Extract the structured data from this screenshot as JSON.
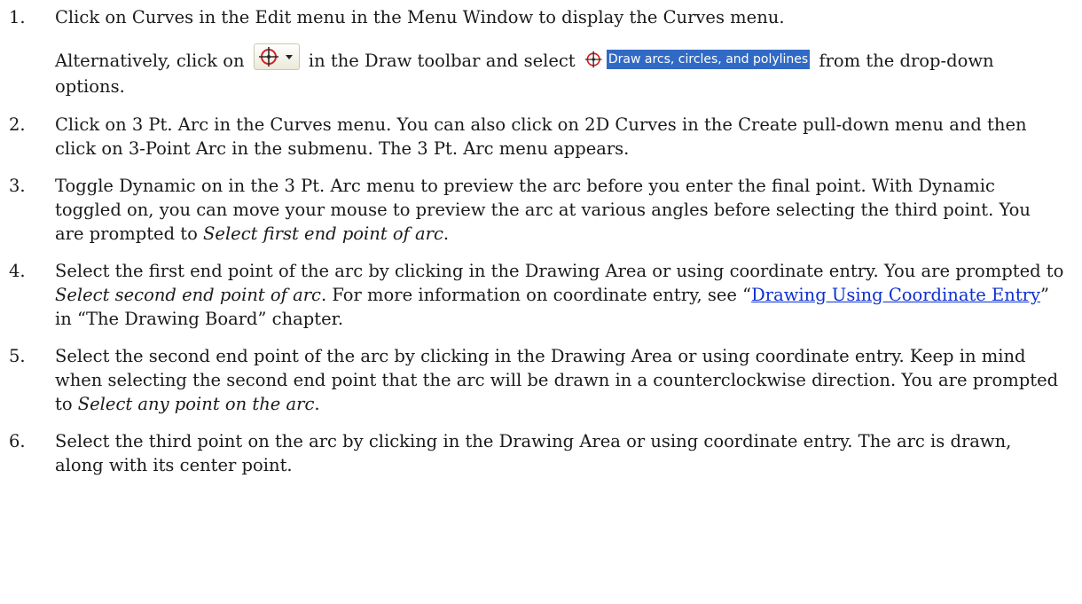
{
  "steps": [
    {
      "number": "1.",
      "text": "Click on Curves in the Edit menu in the Menu Window to display the Curves menu.",
      "alt_before": "Alternatively, click on",
      "alt_middle": "in the Draw toolbar and select",
      "menu_item_label": "Draw arcs, circles, and polylines",
      "alt_after": "from the drop-down options."
    },
    {
      "number": "2.",
      "text": "Click on 3 Pt. Arc in the Curves menu. You can also click on 2D Curves in the Create pull-down menu and then click on 3-Point Arc in the submenu. The 3 Pt. Arc menu appears."
    },
    {
      "number": "3.",
      "text": "Toggle Dynamic on in the 3 Pt. Arc menu to preview the arc before you enter the final point. With Dynamic toggled on, you can move your mouse to preview the arc at various angles before selecting the third point. You are prompted to",
      "prompt": "Select first end point of arc",
      "end": "."
    },
    {
      "number": "4.",
      "text": "Select the first end point of the arc by clicking in the Drawing Area or using coordinate entry. You are prompted to",
      "prompt": "Select second end point of arc",
      "mid": ". For more information on coordinate entry, see “",
      "link": "Drawing Using Coordinate Entry",
      "end": "” in “The Drawing Board” chapter."
    },
    {
      "number": "5.",
      "text": "Select the second end point of the arc by clicking in the Drawing Area or using coordinate entry. Keep in mind when selecting the second end point that the arc will be drawn in a counterclockwise direction. You are prompted to",
      "prompt": "Select any point on the arc",
      "end": "."
    },
    {
      "number": "6.",
      "text": "Select the third point on the arc by clicking in the Drawing Area or using coordinate entry. The arc is drawn, along with its center point."
    }
  ],
  "icons": {
    "toolbar_button": "arc-circle-tool-icon",
    "menu_item": "arc-circle-tool-icon",
    "accent_red": "#d62020",
    "menu_highlight": "#316ac5",
    "link_color": "#0b2fd1"
  }
}
